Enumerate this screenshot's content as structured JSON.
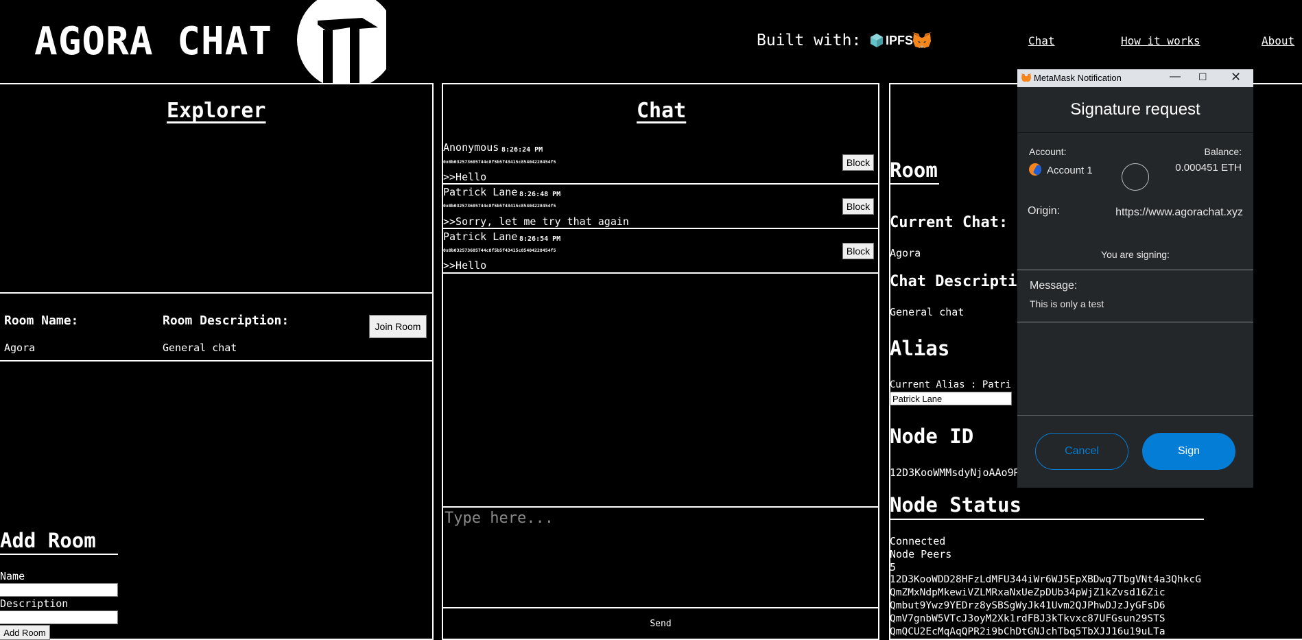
{
  "header": {
    "logo_text": "AGORA CHAT",
    "built_with_label": "Built with:",
    "ipfs_label": "IPFS",
    "nav": [
      {
        "label": "Chat"
      },
      {
        "label": "How it works"
      },
      {
        "label": "About"
      }
    ]
  },
  "explorer": {
    "title": "Explorer",
    "room_name_header": "Room Name:",
    "room_description_header": "Room Description:",
    "rooms": [
      {
        "name": "Agora",
        "description": "General chat",
        "join_label": "Join Room"
      }
    ]
  },
  "add_room": {
    "title": "Add Room",
    "name_label": "Name",
    "description_label": "Description",
    "button_label": "Add Room"
  },
  "chat": {
    "title": "Chat",
    "messages": [
      {
        "author": "Anonymous",
        "time": "8:26:24 PM",
        "address": "0x0b032573605744c8f5b5f43415c85404228454f5",
        "text": ">>Hello",
        "block_label": "Block"
      },
      {
        "author": "Patrick Lane",
        "time": "8:26:48 PM",
        "address": "0x0b032573605744c8f5b5f43415c85404228454f5",
        "text": ">>Sorry, let me try that again",
        "block_label": "Block"
      },
      {
        "author": "Patrick Lane",
        "time": "8:26:54 PM",
        "address": "0x0b032573605744c8f5b5f43415c85404228454f5",
        "text": ">>Hello",
        "block_label": "Block"
      }
    ],
    "input_placeholder": "Type here...",
    "send_label": "Send"
  },
  "room_info": {
    "title": "Room",
    "current_chat_label": "Current Chat:",
    "current_chat_value": "Agora",
    "chat_description_label": "Chat Descripti",
    "chat_description_value": "General chat",
    "alias_title": "Alias",
    "current_alias_label": "Current Alias : Patri",
    "alias_input_value": "Patrick Lane",
    "node_id_title": "Node ID",
    "node_id_value": "12D3KooWMMsdyNjoAAo9R",
    "node_status_title": "Node Status",
    "status_value": "Connected",
    "node_peers_label": "Node Peers",
    "peer_count": "5",
    "peers": [
      "12D3KooWDD28HFzLdMFU344iWr6WJ5EpXBDwq7TbgVNt4a3QhkcG",
      "QmZMxNdpMkewiVZLMRxaNxUeZpDUb34pWjZ1kZvsd16Zic",
      "Qmbut9Ywz9YEDrz8ySBSgWyJk41Uvm2QJPhwDJzJyGFsD6",
      "QmV7gnbW5VTcJ3oyM2Xk1rdFBJ3kTkvxc87UFGsun29STS",
      "QmQCU2EcMqAqQPR2i9bChDtGNJchTbq5TbXJJ16u19uLTa"
    ]
  },
  "metamask": {
    "window_title": "MetaMask Notification",
    "heading": "Signature request",
    "account_label": "Account:",
    "account_name": "Account 1",
    "balance_label": "Balance:",
    "balance_value": "0.000451 ETH",
    "origin_label": "Origin:",
    "origin_value": "https://www.agorachat.xyz",
    "signing_label": "You are signing:",
    "message_label": "Message:",
    "message_value": "This is only a test",
    "cancel_label": "Cancel",
    "sign_label": "Sign",
    "colors": {
      "primary": "#037dd6",
      "cancel_text": "#037dd6"
    }
  }
}
